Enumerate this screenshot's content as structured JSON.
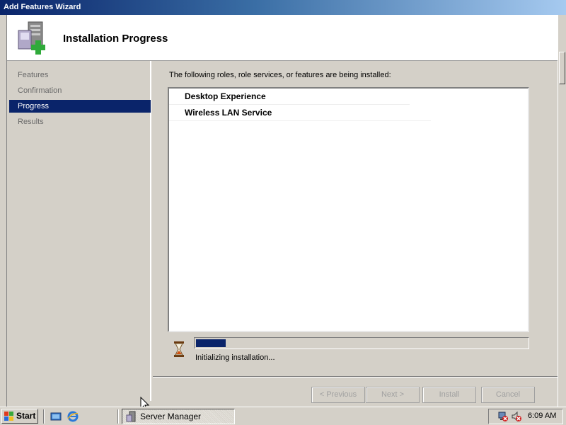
{
  "window": {
    "title": "Add Features Wizard"
  },
  "header": {
    "title": "Installation Progress",
    "icon": "server-add-icon"
  },
  "nav": {
    "items": [
      {
        "label": "Features",
        "active": false
      },
      {
        "label": "Confirmation",
        "active": false
      },
      {
        "label": "Progress",
        "active": true
      },
      {
        "label": "Results",
        "active": false
      }
    ]
  },
  "main": {
    "intro": "The following roles, role services, or features are being installed:",
    "items": [
      "Desktop Experience",
      "Wireless LAN Service"
    ],
    "progress": 0.09,
    "status": "Initializing installation..."
  },
  "buttons": {
    "previous": "< Previous",
    "next": "Next >",
    "install": "Install",
    "cancel": "Cancel"
  },
  "taskbar": {
    "start": "Start",
    "task": "Server Manager",
    "clock": "6:09 AM"
  },
  "colors": {
    "selection": "#0a246a",
    "titlebar": "#0a246a",
    "face": "#d4d0c8"
  }
}
